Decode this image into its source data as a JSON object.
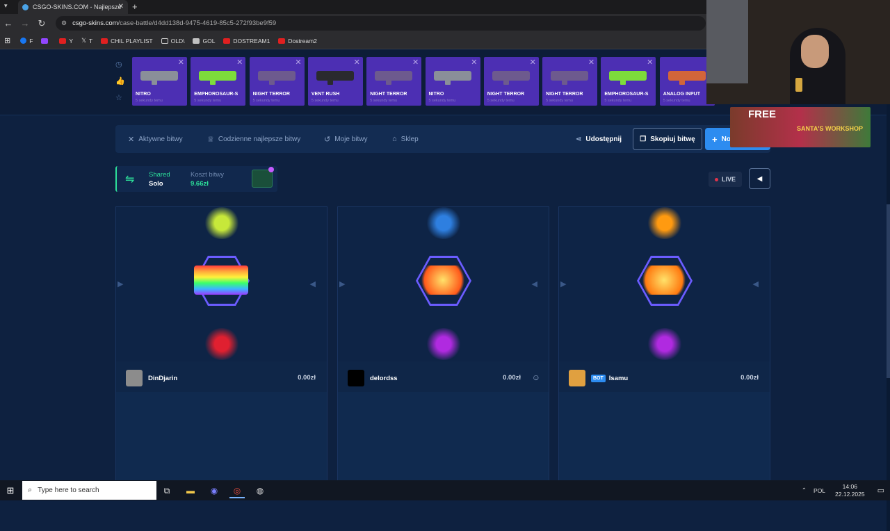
{
  "browser": {
    "tab_title": "CSGO-SKINS.COM - Najlepsze",
    "url_host": "csgo-skins.com",
    "url_path": "/case-battle/d4dd138d-9475-4619-85c5-272f93be9f59",
    "bookmarks": [
      "F",
      "",
      "Y",
      "T",
      "CHIL PLAYLIST",
      "OLD\\",
      "GOL",
      "DOSTREAM1",
      "Dostream2"
    ]
  },
  "drops": [
    {
      "name": "NITRO",
      "time": "5 sekundy temu",
      "color": "#8a8f99"
    },
    {
      "name": "EMPHOROSAUR-S",
      "time": "5 sekundy temu",
      "color": "#7ddc3b"
    },
    {
      "name": "NIGHT TERROR",
      "time": "5 sekundy temu",
      "color": "#6d5a8e"
    },
    {
      "name": "VENT RUSH",
      "time": "5 sekundy temu",
      "color": "#2a2a2e"
    },
    {
      "name": "NIGHT TERROR",
      "time": "5 sekundy temu",
      "color": "#6d5a8e"
    },
    {
      "name": "NITRO",
      "time": "5 sekundy temu",
      "color": "#8a8f99"
    },
    {
      "name": "NIGHT TERROR",
      "time": "5 sekundy temu",
      "color": "#6d5a8e"
    },
    {
      "name": "NIGHT TERROR",
      "time": "5 sekundy temu",
      "color": "#6d5a8e"
    },
    {
      "name": "EMPHOROSAUR-S",
      "time": "5 sekundy temu",
      "color": "#7ddc3b"
    },
    {
      "name": "ANALOG INPUT",
      "time": "5 sekundy temu",
      "color": "#d2653a"
    }
  ],
  "menu": {
    "active": "Aktywne bitwy",
    "daily": "Codzienne najlepsze bitwy",
    "mine": "Moje bitwy",
    "shop": "Sklep",
    "share": "Udostępnij",
    "copy": "Skopiuj bitwę",
    "new": "No"
  },
  "battle": {
    "mode_top": "Shared",
    "mode_bottom": "Solo",
    "cost_label": "Koszt bitwy",
    "cost_value": "9.66zł",
    "live": "LIVE"
  },
  "players": [
    {
      "name": "DinDjarin",
      "amount": "0.00zł",
      "bot": false,
      "avatar_color": "#8c8c8c"
    },
    {
      "name": "delordss",
      "amount": "0.00zł",
      "bot": false,
      "avatar_color": "#000000"
    },
    {
      "name": "Isamu",
      "amount": "0.00zł",
      "bot": true,
      "bot_label": "BOT",
      "avatar_color": "#e0a040"
    }
  ],
  "reels": [
    {
      "top": "#c7e83a",
      "mid": "rainbow",
      "bottom": "#e02030"
    },
    {
      "top": "#2e7fe0",
      "mid": "#ff5a1a",
      "bottom": "#b02ae0"
    },
    {
      "top": "#ff9a10",
      "mid": "#ff7a10",
      "bottom": "#b02ae0"
    }
  ],
  "webcam": {
    "promo_title": "FREE",
    "promo_sub": "SANTA'S WORKSHOP"
  },
  "taskbar": {
    "search_placeholder": "Type here to search",
    "language": "POL",
    "time": "14:06",
    "date": "22.12.2025"
  }
}
